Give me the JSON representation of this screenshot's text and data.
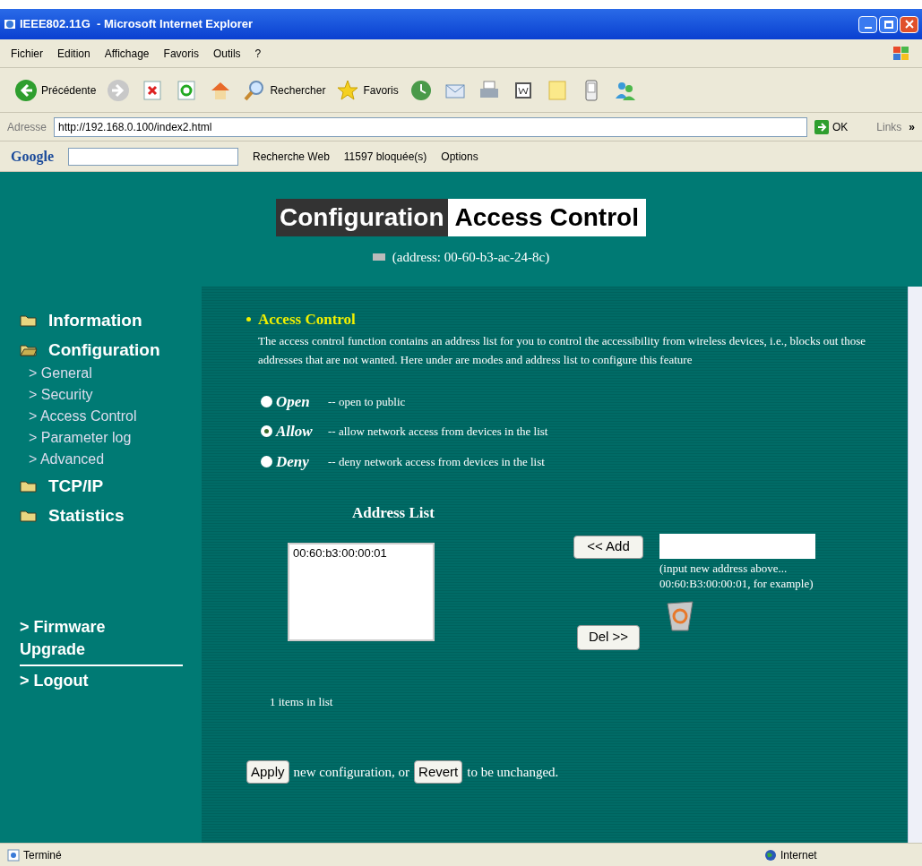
{
  "window": {
    "title": "IEEE802.11G  - Microsoft Internet Explorer"
  },
  "menu": [
    "Fichier",
    "Edition",
    "Affichage",
    "Favoris",
    "Outils",
    "?"
  ],
  "toolbar": [
    {
      "kind": "back",
      "label": "Précédente"
    },
    {
      "kind": "forward"
    },
    {
      "kind": "stop"
    },
    {
      "kind": "refresh"
    },
    {
      "kind": "home"
    },
    {
      "kind": "search",
      "label": "Rechercher"
    },
    {
      "kind": "favorites",
      "label": "Favoris"
    },
    {
      "kind": "history"
    },
    {
      "kind": "mail"
    },
    {
      "kind": "print"
    },
    {
      "kind": "word"
    },
    {
      "kind": "note"
    },
    {
      "kind": "phone"
    },
    {
      "kind": "people"
    }
  ],
  "address": {
    "label": "Adresse",
    "value": "http://192.168.0.100/index2.html",
    "go": "OK",
    "links": "Links",
    "more": "»"
  },
  "google_bar": {
    "logo": "Google",
    "web_search": "Recherche Web",
    "blocked": "11597 bloquée(s)",
    "options": "Options"
  },
  "header": {
    "title_dark": "Configuration",
    "title_light": "Access Control",
    "address": "(address: 00-60-b3-ac-24-8c)"
  },
  "sidebar": [
    {
      "label": "Information",
      "expanded": false
    },
    {
      "label": "Configuration",
      "expanded": true,
      "children": [
        {
          "label": "> General"
        },
        {
          "label": "> Security"
        },
        {
          "label": "> Access Control"
        },
        {
          "label": "> Parameter log"
        },
        {
          "label": "> Advanced"
        }
      ]
    },
    {
      "label": "TCP/IP",
      "expanded": false
    },
    {
      "label": "Statistics",
      "expanded": false
    }
  ],
  "sidebar_links": [
    {
      "label": "> Firmware Upgrade"
    },
    {
      "label": "> Logout"
    }
  ],
  "section": {
    "title": "Access Control",
    "description": "The access control function contains an address list for you to control the accessibility from wireless devices, i.e., blocks out those addresses that are not wanted. Here under are modes and address list to configure this feature"
  },
  "modes": [
    {
      "label": "Open",
      "description": "-- open to public",
      "selected": false
    },
    {
      "label": "Allow",
      "description": "-- allow network access from devices in the list",
      "selected": true
    },
    {
      "label": "Deny",
      "description": "-- deny network access from devices in the list",
      "selected": false
    }
  ],
  "address_list": {
    "title": "Address List",
    "items": [
      "00:60:b3:00:00:01"
    ],
    "add": "<< Add",
    "del": "Del >>",
    "hint": "(input new address above... 00:60:B3:00:00:01, for example)",
    "count": "1 items in list"
  },
  "footer": {
    "apply": "Apply",
    "middle": "new configuration, or",
    "revert": "Revert",
    "end": "to be unchanged."
  },
  "status_bar": {
    "text": "Terminé",
    "zone": "Internet"
  }
}
